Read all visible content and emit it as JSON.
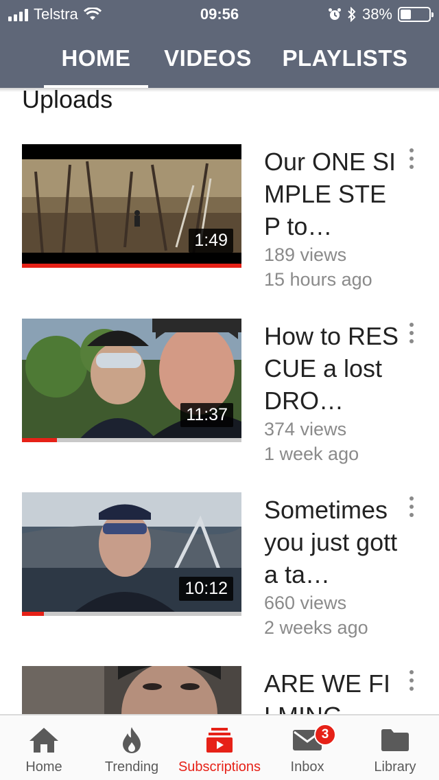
{
  "status_bar": {
    "carrier": "Telstra",
    "time": "09:56",
    "battery_percent": "38%",
    "battery_level": 0.38,
    "icons": [
      "signal-icon",
      "wifi-icon",
      "alarm-icon",
      "bluetooth-icon",
      "battery-icon"
    ]
  },
  "tabs": [
    {
      "label": "HOME",
      "active": true
    },
    {
      "label": "VIDEOS",
      "active": false
    },
    {
      "label": "PLAYLISTS",
      "active": false
    }
  ],
  "section_title": "Uploads",
  "videos": [
    {
      "title": "Our ONE SIMPLE STEP to…",
      "views": "189 views",
      "age": "15 hours ago",
      "duration": "1:49",
      "watched_fraction": 1.0
    },
    {
      "title": "How to RESCUE a lost DRO…",
      "views": "374 views",
      "age": "1 week ago",
      "duration": "11:37",
      "watched_fraction": 0.16
    },
    {
      "title": "Sometimes you just gotta ta…",
      "views": "660 views",
      "age": "2 weeks ago",
      "duration": "10:12",
      "watched_fraction": 0.1
    },
    {
      "title": "ARE WE FILMING…",
      "views": "",
      "age": "",
      "duration": "",
      "watched_fraction": 0
    }
  ],
  "bottom_nav": [
    {
      "label": "Home",
      "icon": "home-icon",
      "active": false
    },
    {
      "label": "Trending",
      "icon": "flame-icon",
      "active": false
    },
    {
      "label": "Subscriptions",
      "icon": "subscriptions-icon",
      "active": true
    },
    {
      "label": "Inbox",
      "icon": "mail-icon",
      "active": false,
      "badge": "3"
    },
    {
      "label": "Library",
      "icon": "folder-icon",
      "active": false
    }
  ],
  "colors": {
    "header": "#5f6778",
    "accent": "#e62117",
    "meta_text": "#8a8a8a"
  }
}
